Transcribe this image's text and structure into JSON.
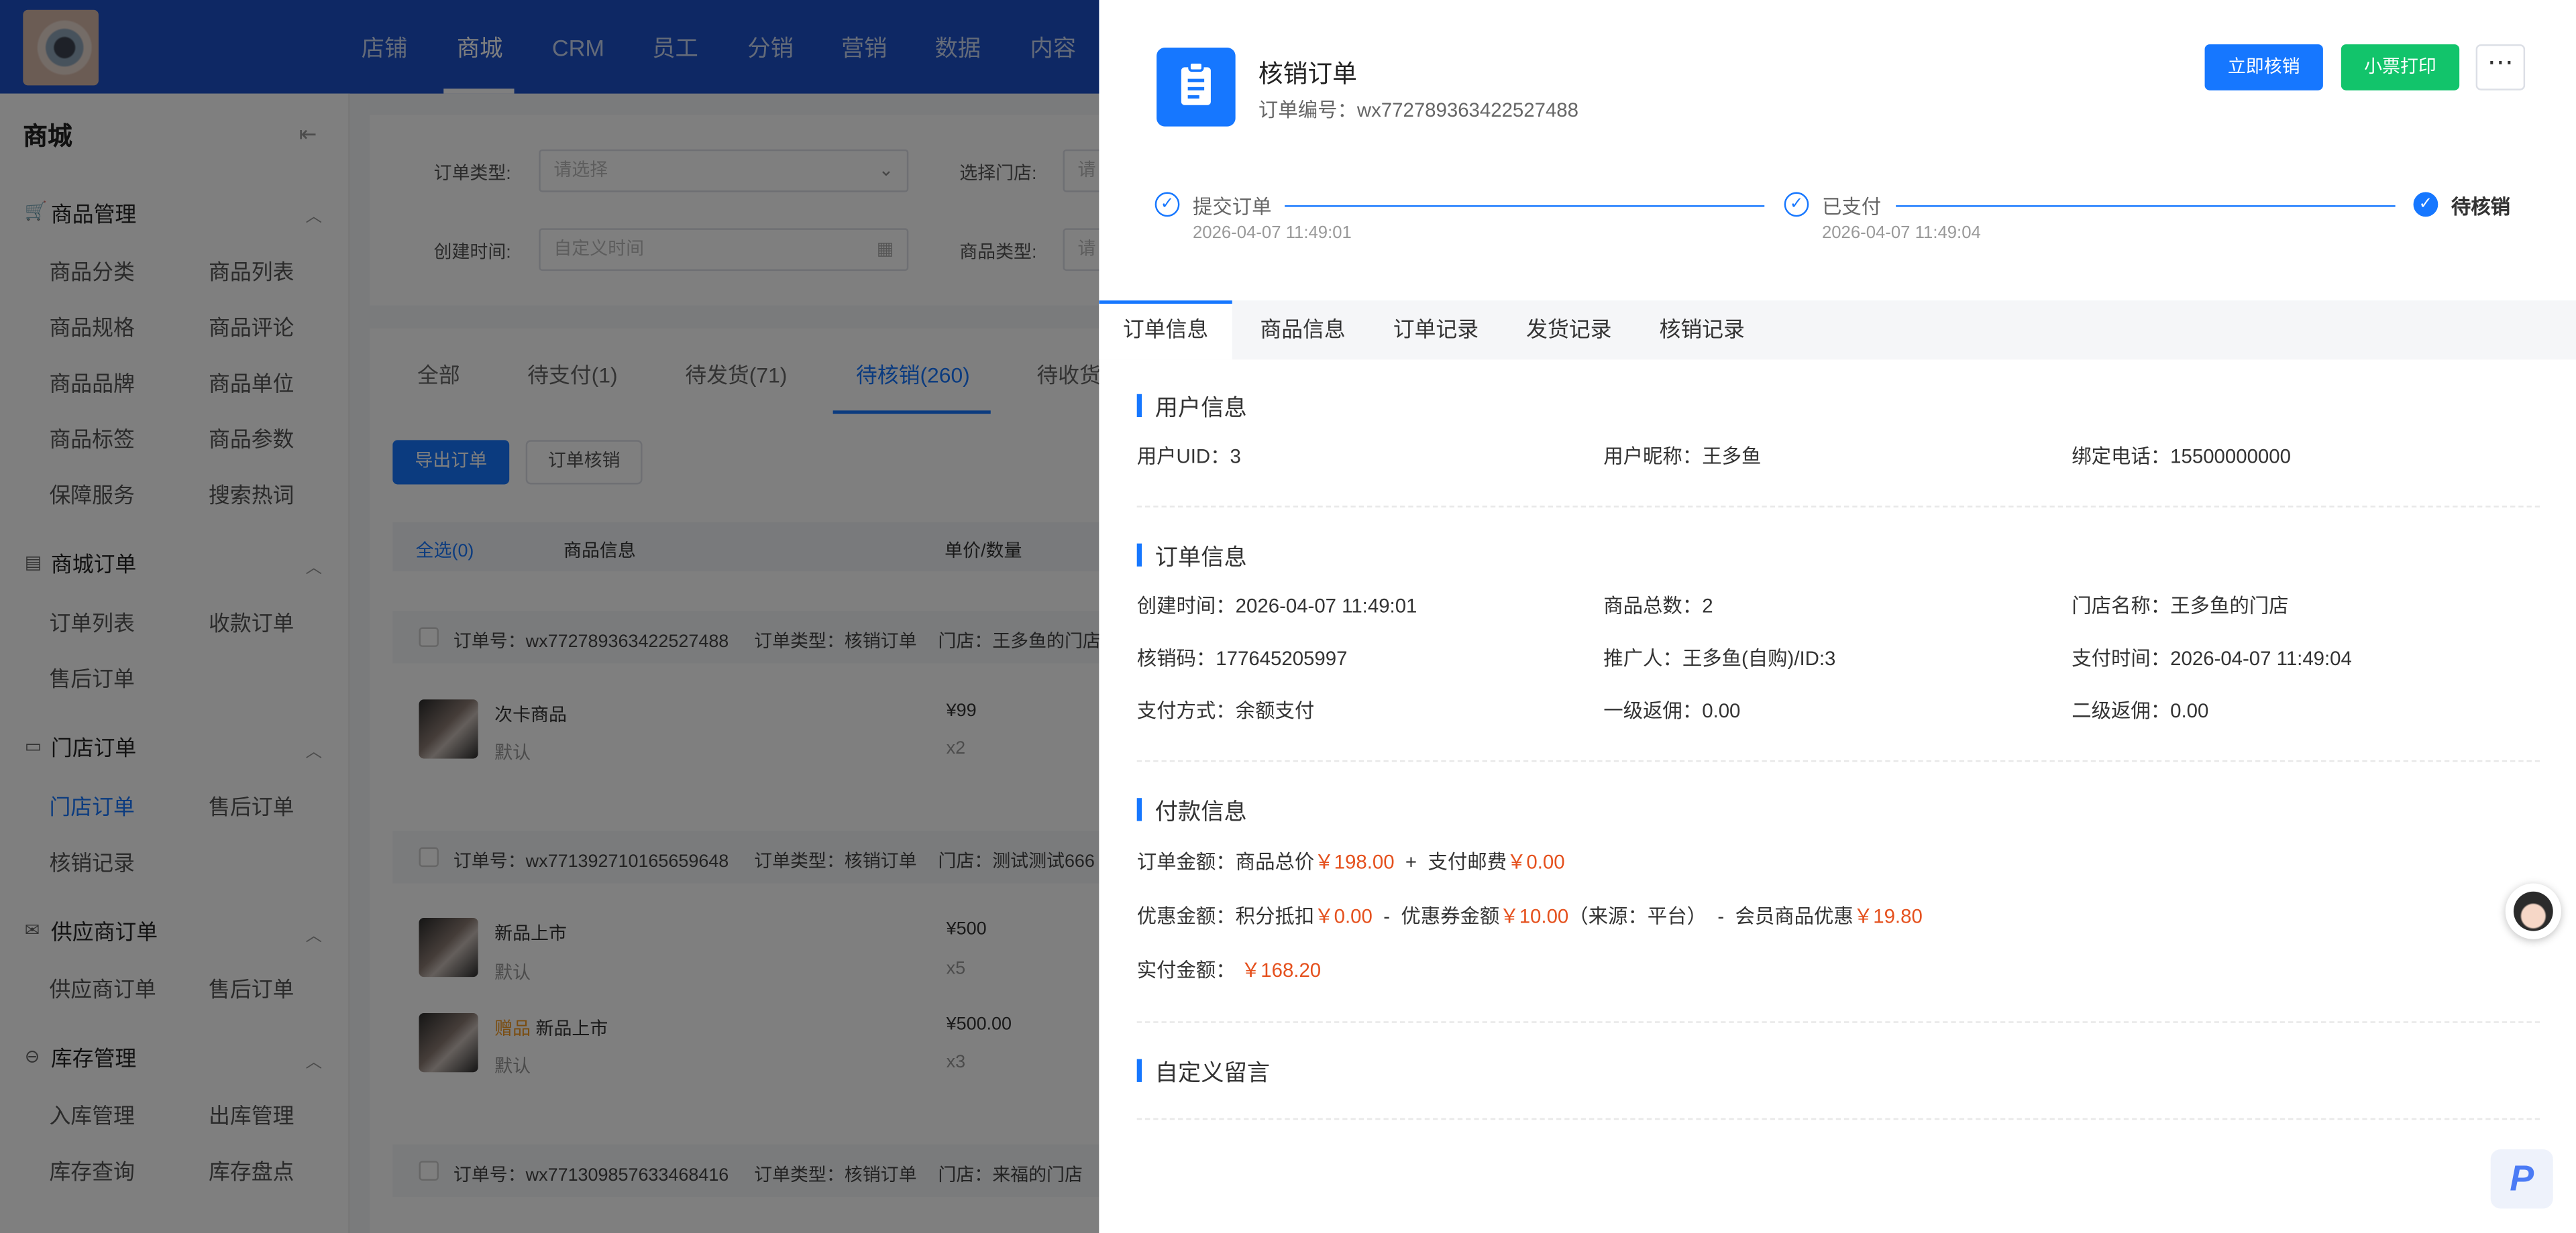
{
  "topnav": {
    "items": [
      "店铺",
      "商城",
      "CRM",
      "员工",
      "分销",
      "营销",
      "数据",
      "内容"
    ],
    "active": "商城"
  },
  "sidebar": {
    "title": "商城",
    "groups": [
      {
        "label": "商品管理",
        "items": [
          "商品分类",
          "商品列表",
          "商品规格",
          "商品评论",
          "商品品牌",
          "商品单位",
          "商品标签",
          "商品参数",
          "保障服务",
          "搜索热词"
        ]
      },
      {
        "label": "商城订单",
        "items": [
          "订单列表",
          "收款订单",
          "售后订单"
        ]
      },
      {
        "label": "门店订单",
        "items": [
          "门店订单",
          "售后订单",
          "核销记录"
        ]
      },
      {
        "label": "供应商订单",
        "items": [
          "供应商订单",
          "售后订单"
        ]
      },
      {
        "label": "库存管理",
        "items": [
          "入库管理",
          "出库管理",
          "库存查询",
          "库存盘点"
        ]
      }
    ],
    "active_item": "门店订单"
  },
  "filters": {
    "order_type_label": "订单类型:",
    "order_type_placeholder": "请选择",
    "store_label": "选择门店:",
    "store_placeholder": "请",
    "created_label": "创建时间:",
    "created_placeholder": "自定义时间",
    "goods_type_label": "商品类型:",
    "goods_type_placeholder": "请"
  },
  "status_tabs": [
    "全部",
    "待支付(1)",
    "待发货(71)",
    "待核销(260)",
    "待收货"
  ],
  "actions": {
    "export": "导出订单",
    "verify": "订单核销"
  },
  "table_head": {
    "select_all": "全选(0)",
    "goods": "商品信息",
    "price_qty": "单价/数量"
  },
  "bg_orders": [
    {
      "no": "订单号：wx772789363422527488",
      "type": "订单类型：核销订单",
      "store": "门店：王多鱼的门店",
      "items": [
        {
          "tag": "",
          "name": "次卡商品",
          "sku": "默认",
          "price": "¥99",
          "qty": "x2"
        }
      ]
    },
    {
      "no": "订单号：wx771392710165659648",
      "type": "订单类型：核销订单",
      "store": "门店：测试测试666",
      "items": [
        {
          "tag": "",
          "name": "新品上市",
          "sku": "默认",
          "price": "¥500",
          "qty": "x5"
        },
        {
          "tag": "赠品",
          "name": "新品上市",
          "sku": "默认",
          "price": "¥500.00",
          "qty": "x3"
        }
      ]
    },
    {
      "no": "订单号：wx771309857633468416",
      "type": "订单类型：核销订单",
      "store": "门店：来福的门店",
      "items": []
    }
  ],
  "drawer": {
    "title": "核销订单",
    "order_no": "订单编号：wx772789363422527488",
    "buttons": {
      "verify": "立即核销",
      "print": "小票打印",
      "more": "⋯"
    },
    "steps": [
      {
        "title": "提交订单",
        "time": "2026-04-07 11:49:01",
        "icon": "check-icon"
      },
      {
        "title": "已支付",
        "time": "2026-04-07 11:49:04",
        "icon": "check-icon"
      },
      {
        "title": "待核销",
        "time": "",
        "icon": "check-icon"
      }
    ],
    "tabs": [
      "订单信息",
      "商品信息",
      "订单记录",
      "发货记录",
      "核销记录"
    ],
    "active_tab": "订单信息",
    "sections": {
      "user_title": "用户信息",
      "user": [
        {
          "label": "用户UID：",
          "value": "3"
        },
        {
          "label": "用户昵称：",
          "value": "王多鱼"
        },
        {
          "label": "绑定电话：",
          "value": "15500000000"
        }
      ],
      "order_title": "订单信息",
      "order": [
        {
          "label": "创建时间：",
          "value": "2026-04-07 11:49:01"
        },
        {
          "label": "商品总数：",
          "value": "2"
        },
        {
          "label": "门店名称：",
          "value": "王多鱼的门店"
        },
        {
          "label": "核销码：",
          "value": "177645205997"
        },
        {
          "label": "推广人：",
          "value": "王多鱼(自购)/ID:3"
        },
        {
          "label": "支付时间：",
          "value": "2026-04-07 11:49:04"
        },
        {
          "label": "支付方式：",
          "value": "余额支付"
        },
        {
          "label": "一级返佣：",
          "value": "0.00"
        },
        {
          "label": "二级返佣：",
          "value": "0.00"
        }
      ],
      "pay_title": "付款信息",
      "pay": {
        "line1": {
          "label": "订单金额：",
          "goods_label": "商品总价",
          "goods_value": "￥198.00",
          "plus": "+",
          "postage_label": "支付邮费",
          "postage_value": "￥0.00"
        },
        "line2": {
          "label": "优惠金额：",
          "points_label": "积分抵扣",
          "points_value": "￥0.00",
          "minus1": "-",
          "coupon_label": "优惠券金额",
          "coupon_value": "￥10.00",
          "coupon_source": "（来源：平台）",
          "minus2": "-",
          "member_label": "会员商品优惠",
          "member_value": "￥19.80"
        },
        "line3": {
          "label": "实付金额：",
          "value": "￥168.20"
        }
      },
      "custom_title": "自定义留言"
    }
  },
  "colors": {
    "brand": "#1d50c9",
    "primary": "#1677ff",
    "green": "#12c46b",
    "price_red": "#e5511e"
  },
  "floating": {
    "customer_service": "customer-service-avatar",
    "logo_letter": "P"
  }
}
